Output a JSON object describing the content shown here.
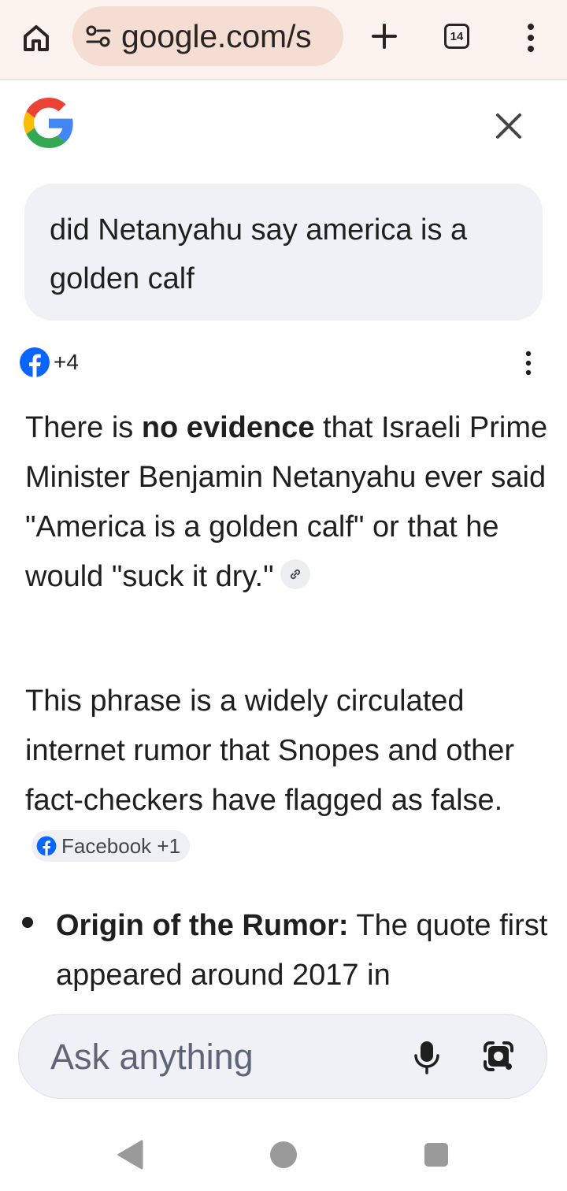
{
  "browser": {
    "url": "google.com/s",
    "tab_count": "14",
    "icons": [
      "home-icon",
      "site-settings-icon",
      "plus-icon",
      "tab-switcher-icon",
      "more-vertical-icon"
    ]
  },
  "search": {
    "query": "did Netanyahu say america is a golden calf"
  },
  "sources": {
    "count_label": "+4"
  },
  "answer": {
    "p1_before": "There is ",
    "p1_bold": "no evidence",
    "p1_after": " that Israeli Prime Minister Benjamin Netanyahu ever said \"America is a golden calf\" or that he would \"suck it dry.\"",
    "p2": "This phrase is a widely circulated internet rumor that Snopes and other fact-checkers have flagged as false.",
    "p2_chip": "Facebook +1",
    "bullet_title": "Origin of the Rumor:",
    "bullet_text": " The quote first appeared around 2017 in"
  },
  "input": {
    "placeholder": "Ask anything"
  },
  "colors": {
    "topbar": "#fdf3ee",
    "url_pill": "#f4ddd2",
    "bubble": "#eff1f6",
    "facebook": "#0866ff",
    "google_blue": "#4285f4",
    "google_red": "#ea4335",
    "google_yellow": "#fbbc05",
    "google_green": "#34a853"
  }
}
